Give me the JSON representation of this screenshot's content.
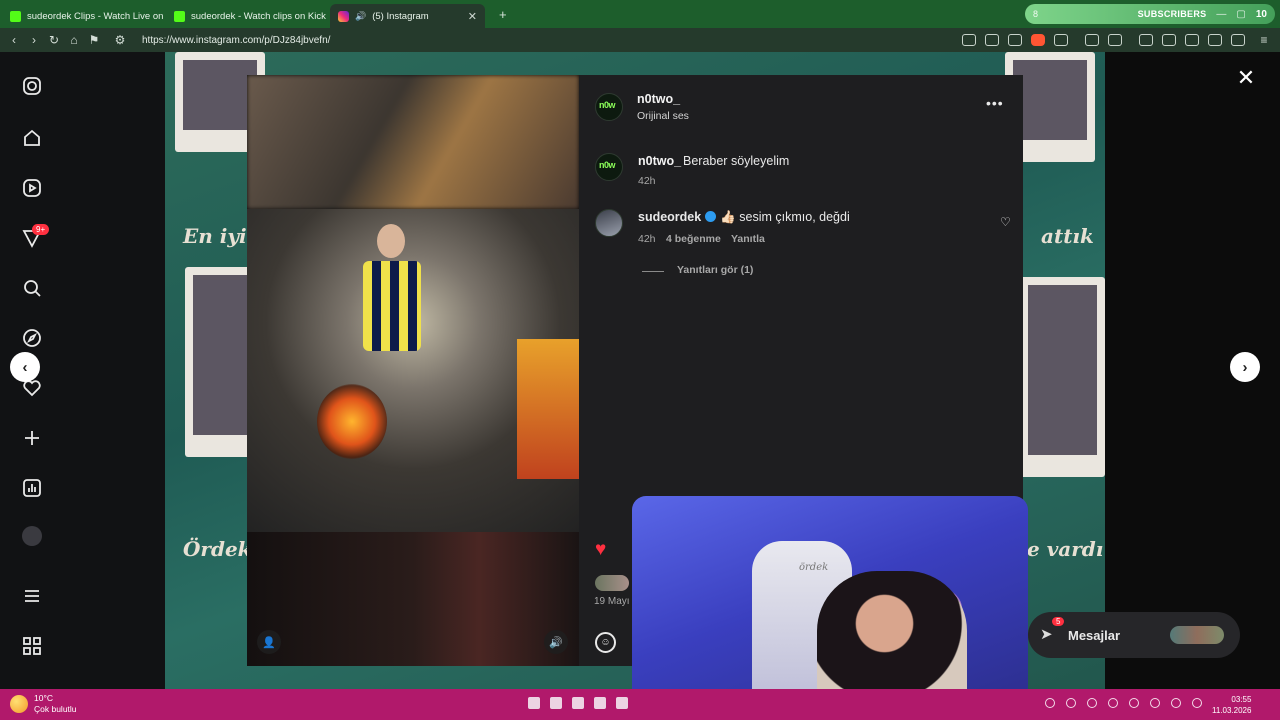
{
  "browser": {
    "tabs": [
      {
        "title": "sudeordek Clips - Watch Live on Kick",
        "icon": "kick-icon"
      },
      {
        "title": "sudeordek - Watch clips on Kick",
        "icon": "kick-icon"
      },
      {
        "title": "(5) Instagram",
        "icon": "instagram-icon",
        "active": true
      }
    ],
    "new_tab": "+",
    "url": "https://www.instagram.com/p/DJz84jbvefn/",
    "subscribers_widget": {
      "left_count": "8",
      "label": "SUBSCRIBERS",
      "right_count": "10"
    }
  },
  "post": {
    "author": "n0two_",
    "audio": "Orijinal ses",
    "more": "•••",
    "caption": {
      "user": "n0two_",
      "text": "Beraber söyleyelim",
      "time": "42h"
    },
    "comment": {
      "user": "sudeordek",
      "emoji": "👍🏻",
      "text": "sesim çıkmıo, değdi",
      "time": "42h",
      "likes": "4 beğenme",
      "reply": "Yanıtla"
    },
    "view_replies": "Yanıtları gör (1)",
    "date": "19 Mayı"
  },
  "sidebar": {
    "notification_badge": "9+"
  },
  "backdrop": {
    "script_left_top": "En iyi ş",
    "script_right_top": "attık",
    "script_left_bottom": "Ördek ş",
    "script_right_bottom": "e vardı"
  },
  "messages": {
    "label": "Mesajlar",
    "badge": "5"
  },
  "taskbar": {
    "temp": "10°C",
    "weather": "Çok bulutlu",
    "time": "03:55",
    "date": "11.03.2026"
  },
  "colors": {
    "accent_like": "#ff3040",
    "verified": "#2d9cf0",
    "taskbar": "#b1196b",
    "kick": "#53fc18"
  }
}
